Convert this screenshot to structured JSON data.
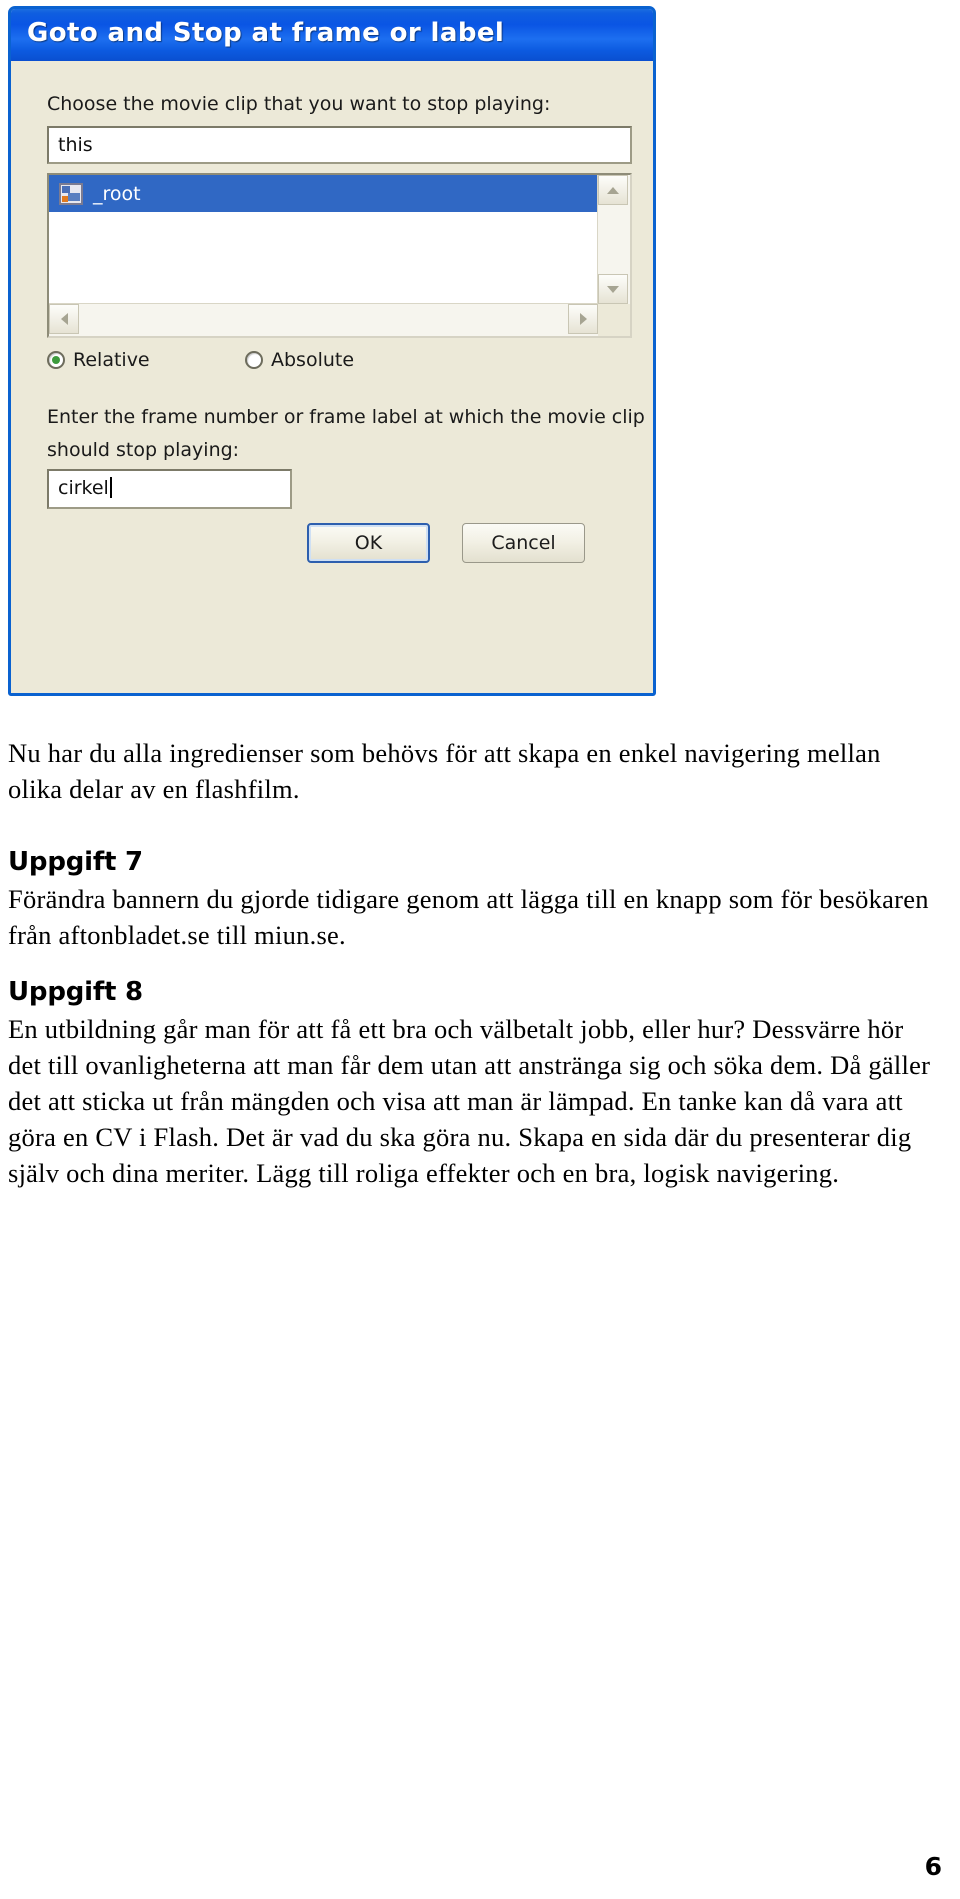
{
  "dialog": {
    "title": "Goto and Stop at frame or label",
    "choose_label": "Choose the movie clip that you want to stop playing:",
    "target_field_value": "this",
    "list": {
      "items": [
        {
          "label": "_root",
          "selected": true
        }
      ]
    },
    "radios": [
      {
        "label": "Relative",
        "checked": true
      },
      {
        "label": "Absolute",
        "checked": false
      }
    ],
    "frame_label_line1": "Enter the frame number or frame label at which the movie clip",
    "frame_label_line2": "should stop playing:",
    "frame_field_value": "cirkel",
    "buttons": {
      "ok": "OK",
      "cancel": "Cancel"
    },
    "colors": {
      "titlebar_blue": "#0a55e4",
      "dialog_face": "#ece9d8",
      "selection_blue": "#3068c4",
      "radio_dot_green": "#3d9b3d",
      "focus_border": "#2d5fae"
    }
  },
  "document": {
    "intro_paragraph": "Nu har du alla ingredienser som behövs för att skapa en enkel navigering mellan olika delar av en flashfilm.",
    "section_7": {
      "heading": "Uppgift 7",
      "body": "Förändra bannern du gjorde tidigare genom att lägga till en knapp som för besökaren från aftonbladet.se till miun.se."
    },
    "section_8": {
      "heading": "Uppgift 8",
      "body": "En utbildning går man för att få ett bra och välbetalt jobb, eller hur? Dessvärre hör det till ovanligheterna att man får dem utan att anstränga sig och söka dem. Då gäller det att sticka ut från mängden och visa att man är lämpad. En tanke kan då vara att göra en CV i Flash. Det är vad du ska göra nu. Skapa en sida där du presenterar dig själv och dina meriter. Lägg till roliga effekter och en bra, logisk navigering."
    },
    "page_number": "6"
  }
}
